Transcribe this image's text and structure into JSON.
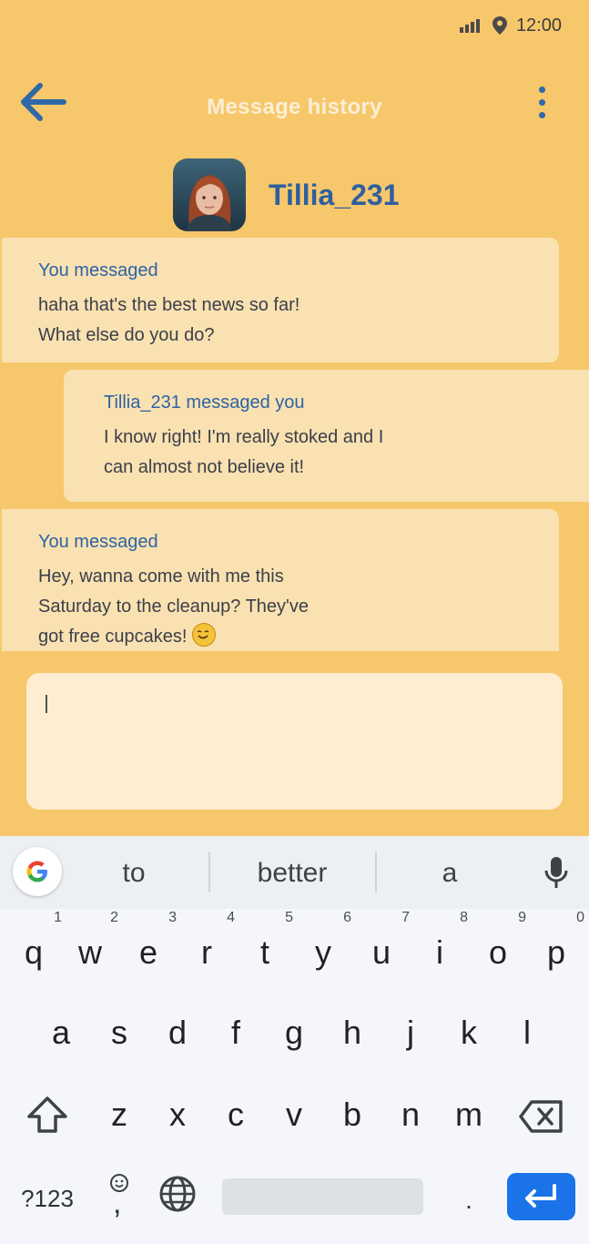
{
  "status": {
    "time": "12:00"
  },
  "header": {
    "title": "Message history",
    "back_icon": "arrow-left-icon",
    "menu_icon": "more-vertical-icon"
  },
  "contact": {
    "username": "Tillia_231"
  },
  "messages": [
    {
      "who": "You messaged",
      "lines": [
        "haha that's the best news so far!",
        "What else do you do?"
      ]
    },
    {
      "who": "Tillia_231 messaged you",
      "lines": [
        "I know right! I'm really stoked and I",
        "can almost not believe it!"
      ]
    },
    {
      "who": "You messaged",
      "lines": [
        "Hey, wanna come with me this",
        "Saturday to the cleanup? They've",
        "got free cupcakes!"
      ]
    }
  ],
  "input": {
    "value": ""
  },
  "keyboard": {
    "suggestions": [
      "to",
      "better",
      "a"
    ],
    "row1": [
      {
        "k": "q",
        "n": "1"
      },
      {
        "k": "w",
        "n": "2"
      },
      {
        "k": "e",
        "n": "3"
      },
      {
        "k": "r",
        "n": "4"
      },
      {
        "k": "t",
        "n": "5"
      },
      {
        "k": "y",
        "n": "6"
      },
      {
        "k": "u",
        "n": "7"
      },
      {
        "k": "i",
        "n": "8"
      },
      {
        "k": "o",
        "n": "9"
      },
      {
        "k": "p",
        "n": "0"
      }
    ],
    "row2": [
      "a",
      "s",
      "d",
      "f",
      "g",
      "h",
      "j",
      "k",
      "l"
    ],
    "row3": [
      "z",
      "x",
      "c",
      "v",
      "b",
      "n",
      "m"
    ],
    "symbols_label": "?123",
    "comma_label": ",",
    "period_label": ".",
    "colors": {
      "enter": "#1a73e8"
    }
  },
  "colors": {
    "background": "#f7c76b",
    "accent": "#2f5f9e",
    "bubble": "#f9e1b1"
  }
}
